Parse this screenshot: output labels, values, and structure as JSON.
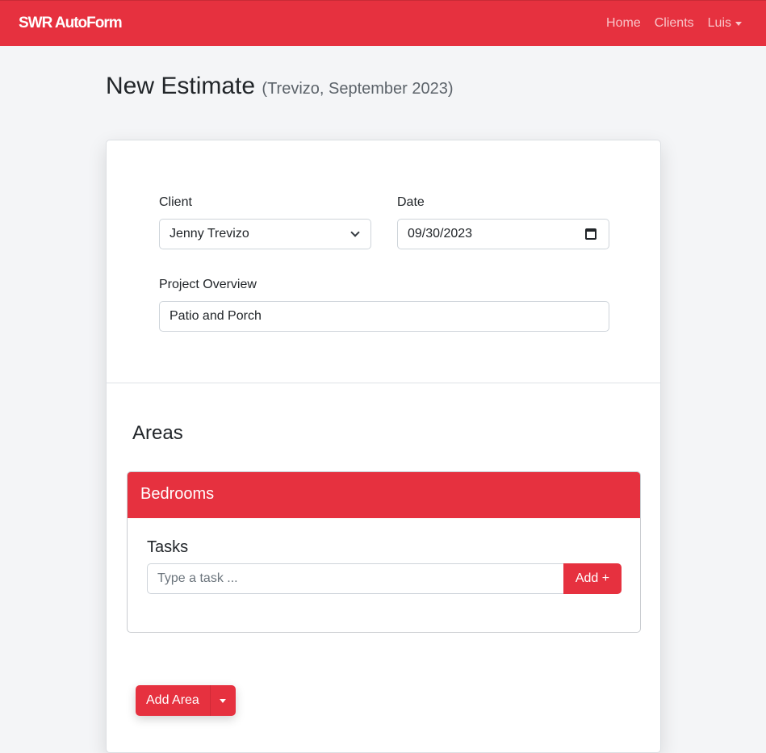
{
  "nav": {
    "brand": "SWR AutoForm",
    "links": [
      "Home",
      "Clients"
    ],
    "user": "Luis"
  },
  "page": {
    "title": "New Estimate",
    "subtitle": "(Trevizo, September 2023)"
  },
  "form": {
    "client_label": "Client",
    "client_value": "Jenny Trevizo",
    "date_label": "Date",
    "date_value": "09/30/2023",
    "overview_label": "Project Overview",
    "overview_value": "Patio and Porch"
  },
  "areas": {
    "title": "Areas",
    "items": [
      {
        "name": "Bedrooms",
        "tasks_title": "Tasks",
        "task_placeholder": "Type a task ...",
        "add_label": "Add +"
      }
    ],
    "add_area_label": "Add Area"
  },
  "colors": {
    "accent": "#e6313f",
    "background": "#f4f5f7"
  },
  "icons": [
    "chevron-down-icon",
    "calendar-icon",
    "caret-down-icon"
  ]
}
